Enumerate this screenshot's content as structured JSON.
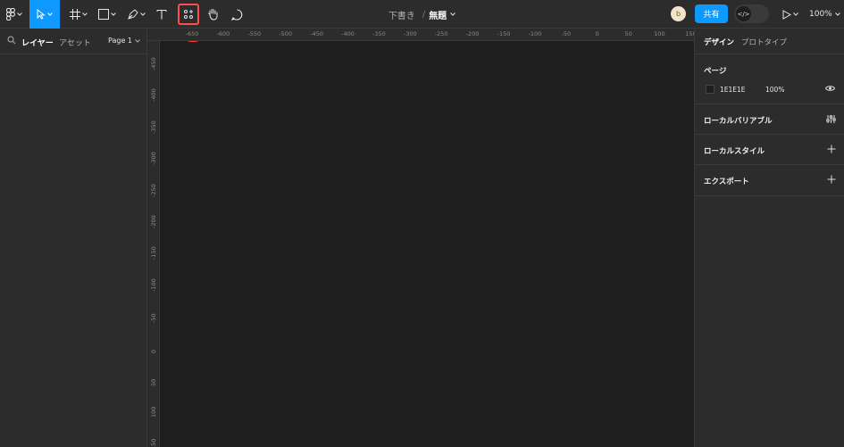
{
  "toolbar": {
    "file_crumb": "下書き",
    "separator": "/",
    "file_name": "無題",
    "share_label": "共有",
    "zoom_label": "100%",
    "dev_mode_icon": "</>",
    "avatar_initial": "b",
    "active_tool": "move-tool",
    "highlighted_tool": "actions-tool"
  },
  "left_panel": {
    "tab_layers": "レイヤー",
    "tab_assets": "アセット",
    "page_selector": "Page 1"
  },
  "rulers": {
    "top_labels": [
      "-650",
      "-600",
      "-550",
      "-500",
      "-450",
      "-400",
      "-350",
      "-300",
      "-250",
      "-200",
      "-150",
      "-100",
      "-50",
      "0",
      "50",
      "100",
      "150"
    ],
    "left_labels": [
      "-450",
      "-400",
      "-350",
      "-300",
      "-250",
      "-200",
      "-150",
      "-100",
      "-50",
      "0",
      "50",
      "100",
      "150"
    ]
  },
  "right_panel": {
    "tab_design": "デザイン",
    "tab_prototype": "プロトタイプ",
    "page_section_title": "ページ",
    "page_color_hex": "1E1E1E",
    "page_opacity": "100%",
    "local_variables_title": "ローカルバリアブル",
    "local_styles_title": "ローカルスタイル",
    "export_title": "エクスポート"
  },
  "colors": {
    "accent": "#0d99ff",
    "highlight": "#ff4d4d",
    "canvas": "#1e1e1e",
    "panel": "#2c2c2c"
  }
}
